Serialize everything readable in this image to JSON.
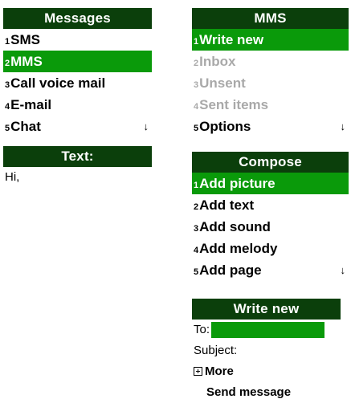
{
  "messages_panel": {
    "title": "Messages",
    "items": [
      {
        "num": "1",
        "label": "SMS"
      },
      {
        "num": "2",
        "label": "MMS"
      },
      {
        "num": "3",
        "label": "Call voice mail"
      },
      {
        "num": "4",
        "label": "E-mail"
      },
      {
        "num": "5",
        "label": "Chat"
      }
    ],
    "scroll_indicator": "↓"
  },
  "mms_panel": {
    "title": "MMS",
    "items": [
      {
        "num": "1",
        "label": "Write new"
      },
      {
        "num": "2",
        "label": "Inbox"
      },
      {
        "num": "3",
        "label": "Unsent"
      },
      {
        "num": "4",
        "label": "Sent items"
      },
      {
        "num": "5",
        "label": "Options"
      }
    ],
    "scroll_indicator": "↓"
  },
  "text_panel": {
    "title": "Text:",
    "body": "Hi,"
  },
  "compose_panel": {
    "title": "Compose",
    "items": [
      {
        "num": "1",
        "label": "Add picture"
      },
      {
        "num": "2",
        "label": "Add text"
      },
      {
        "num": "3",
        "label": "Add sound"
      },
      {
        "num": "4",
        "label": "Add melody"
      },
      {
        "num": "5",
        "label": "Add page"
      }
    ],
    "scroll_indicator": "↓"
  },
  "write_new_panel": {
    "title": "Write new",
    "to_label": "To:",
    "to_value": "",
    "subject_label": "Subject:",
    "more_label": "More",
    "send_label": "Send message"
  },
  "colors": {
    "title_bar": "#0b3f0b",
    "selection": "#0a9a0a",
    "disabled": "#a9a9a9"
  }
}
